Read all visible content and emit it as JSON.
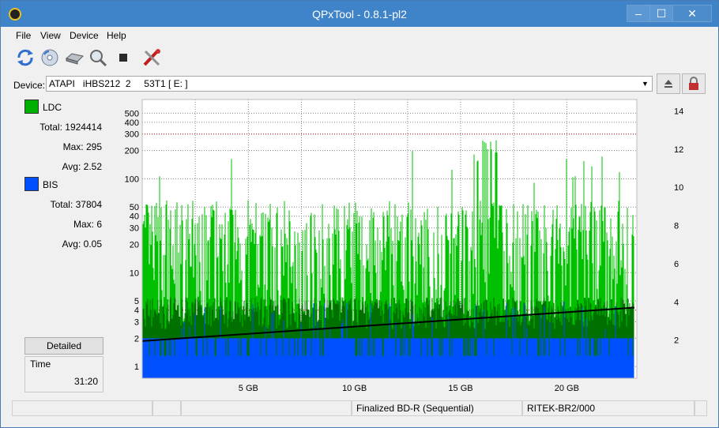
{
  "window": {
    "title": "QPxTool - 0.8.1-pl2",
    "minimize": "–",
    "maximize": "☐",
    "close": "✕"
  },
  "menu": [
    "File",
    "View",
    "Device",
    "Help"
  ],
  "toolbar": [
    {
      "name": "refresh-icon"
    },
    {
      "name": "disc-info-icon"
    },
    {
      "name": "drive-icon"
    },
    {
      "name": "scan-icon"
    },
    {
      "name": "stop-icon"
    },
    {
      "name": "settings-tools-icon"
    }
  ],
  "device": {
    "label": "Device:",
    "value": "ATAPI   iHBS212  2     53T1 [ E: ]"
  },
  "left_panel": {
    "ldc": {
      "name": "LDC",
      "color": "#00b000",
      "total_label": "Total:",
      "total": "1924414",
      "max_label": "Max:",
      "max": "295",
      "avg_label": "Avg:",
      "avg": "2.52"
    },
    "bis": {
      "name": "BIS",
      "color": "#0050ff",
      "total_label": "Total:",
      "total": "37804",
      "max_label": "Max:",
      "max": "6",
      "avg_label": "Avg:",
      "avg": "0.05"
    },
    "detailed": "Detailed",
    "time_label": "Time",
    "time": "31:20"
  },
  "chart_data": {
    "type": "area",
    "series": [
      {
        "name": "LDC",
        "color": "#00c000",
        "scale": "log",
        "max": 295,
        "avg": 2.52
      },
      {
        "name": "BIS",
        "color": "#0050ff",
        "scale": "log",
        "max": 6,
        "avg": 0.05
      }
    ],
    "x_ticks": [
      "5 GB",
      "10 GB",
      "15 GB",
      "20 GB"
    ],
    "x_tick_values": [
      5,
      10,
      15,
      20
    ],
    "xlim": [
      0,
      23.3
    ],
    "y_left_ticks": [
      "1",
      "2",
      "3",
      "4",
      "5",
      "10",
      "20",
      "30",
      "40",
      "50",
      "100",
      "200",
      "300",
      "400",
      "500"
    ],
    "y_left_values": [
      1,
      2,
      3,
      4,
      5,
      10,
      20,
      30,
      40,
      50,
      100,
      200,
      300,
      400,
      500
    ],
    "ylim_left": [
      0.75,
      700
    ],
    "y_right_ticks": [
      "2",
      "4",
      "6",
      "8",
      "10",
      "12",
      "14"
    ],
    "y_right_values": [
      2,
      4,
      6,
      8,
      10,
      12,
      14
    ],
    "ylim_right": [
      0,
      14.6
    ],
    "speed_line": {
      "start": 1.95,
      "end": 3.7
    },
    "grid": true
  },
  "status": [
    "",
    "",
    "",
    "Finalized BD-R (Sequential)",
    "RITEK-BR2/000",
    ""
  ]
}
